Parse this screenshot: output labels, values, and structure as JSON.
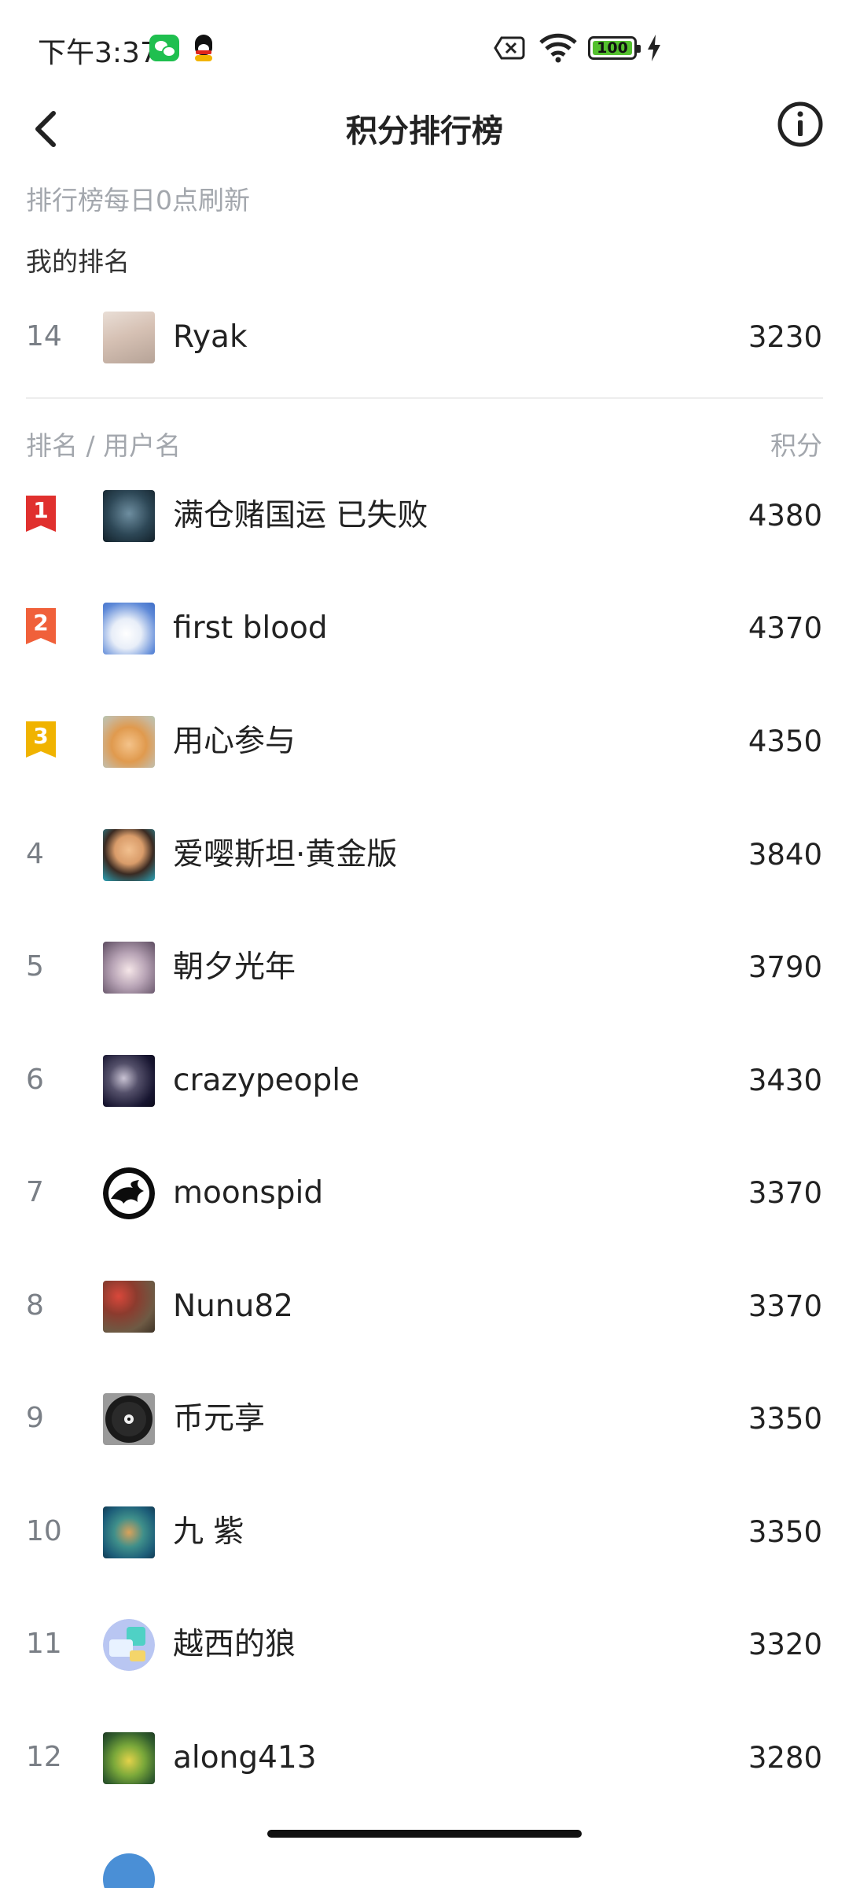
{
  "status_bar": {
    "time": "下午3:37",
    "battery": "100",
    "icons": [
      "wechat-icon",
      "qq-icon",
      "no-sim-icon",
      "wifi-icon",
      "battery-icon",
      "charging-icon"
    ]
  },
  "header": {
    "title": "积分排行榜",
    "back_icon": "chevron-left-icon",
    "info_icon": "info-circle-icon"
  },
  "notice": "排行榜每日0点刷新",
  "my_rank": {
    "label": "我的排名",
    "rank": "14",
    "name": "Ryak",
    "score": "3230"
  },
  "columns": {
    "left": "排名 / 用户名",
    "right": "积分"
  },
  "colors": {
    "badge_1": "#e0302e",
    "badge_2": "#f0603a",
    "badge_3": "#f0b300",
    "muted_text": "#a3a7ad",
    "rank_text": "#7a7f86"
  },
  "ranking": [
    {
      "rank": "1",
      "name": "满仓赌国运 已失败",
      "score": "4380"
    },
    {
      "rank": "2",
      "name": "first blood",
      "score": "4370"
    },
    {
      "rank": "3",
      "name": "用心参与",
      "score": "4350"
    },
    {
      "rank": "4",
      "name": "爱嘤斯坦·黄金版",
      "score": "3840"
    },
    {
      "rank": "5",
      "name": "朝夕光年",
      "score": "3790"
    },
    {
      "rank": "6",
      "name": "crazypeople",
      "score": "3430"
    },
    {
      "rank": "7",
      "name": "moonspid",
      "score": "3370"
    },
    {
      "rank": "8",
      "name": "Nunu82",
      "score": "3370"
    },
    {
      "rank": "9",
      "name": "币元享",
      "score": "3350"
    },
    {
      "rank": "10",
      "name": "九 紫",
      "score": "3350"
    },
    {
      "rank": "11",
      "name": "越西的狼",
      "score": "3320"
    },
    {
      "rank": "12",
      "name": "along413",
      "score": "3280"
    }
  ]
}
